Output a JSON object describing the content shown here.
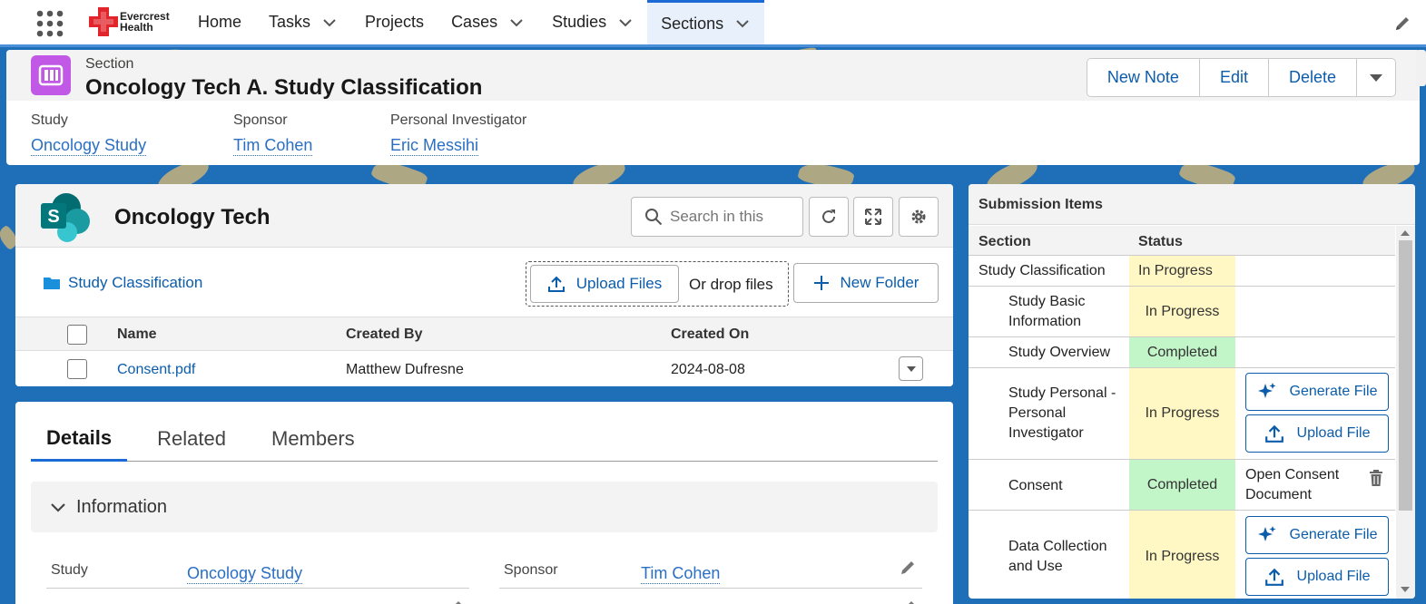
{
  "brand": {
    "line1": "Evercrest",
    "line2": "Health"
  },
  "nav": {
    "items": [
      {
        "label": "Home"
      },
      {
        "label": "Tasks"
      },
      {
        "label": "Projects"
      },
      {
        "label": "Cases"
      },
      {
        "label": "Studies"
      },
      {
        "label": "Sections"
      }
    ]
  },
  "record": {
    "object_label": "Section",
    "title": "Oncology Tech A. Study Classification",
    "buttons": {
      "new_note": "New Note",
      "edit": "Edit",
      "delete": "Delete"
    },
    "fields": [
      {
        "label": "Study",
        "value": "Oncology Study"
      },
      {
        "label": "Sponsor",
        "value": "Tim Cohen"
      },
      {
        "label": "Personal Investigator",
        "value": "Eric Messihi"
      }
    ]
  },
  "files": {
    "title": "Oncology Tech",
    "search_placeholder": "Search in this",
    "folder": "Study Classification",
    "upload_label": "Upload Files",
    "drop_label": "Or drop files",
    "new_folder_label": "New Folder",
    "columns": {
      "name": "Name",
      "created_by": "Created By",
      "created_on": "Created On"
    },
    "rows": [
      {
        "name": "Consent.pdf",
        "created_by": "Matthew Dufresne",
        "created_on": "2024-08-08"
      }
    ]
  },
  "details": {
    "tabs": [
      {
        "label": "Details"
      },
      {
        "label": "Related"
      },
      {
        "label": "Members"
      }
    ],
    "section_title": "Information",
    "fields": [
      {
        "label": "Study",
        "value": "Oncology Study"
      },
      {
        "label": "Sponsor",
        "value": "Tim Cohen"
      }
    ]
  },
  "submission": {
    "title": "Submission Items",
    "columns": {
      "section": "Section",
      "status": "Status"
    },
    "items": [
      {
        "name": "Study Classification",
        "status": "In Progress"
      },
      {
        "name": "Study Basic Information",
        "status": "In Progress"
      },
      {
        "name": "Study Overview",
        "status": "Completed"
      },
      {
        "name": "Study Personal - Personal Investigator",
        "status": "In Progress",
        "actions": [
          "Generate File",
          "Upload File"
        ]
      },
      {
        "name": "Consent",
        "status": "Completed",
        "link": "Open Consent Document"
      },
      {
        "name": "Data Collection and Use",
        "status": "In Progress",
        "actions": [
          "Generate File",
          "Upload File"
        ]
      }
    ]
  },
  "colors": {
    "accent": "#1b6ad6",
    "in_progress": "#fff8c4",
    "completed": "#c2f5c8",
    "section_icon": "#c158e6"
  },
  "icons": {
    "waffle": "app-launcher-icon",
    "pencil": "edit-pencil-icon",
    "search": "search-icon",
    "refresh": "refresh-icon",
    "expand": "expand-icon",
    "settings": "gear-icon",
    "folder": "folder-icon",
    "upload": "upload-icon",
    "add": "plus-icon",
    "sparkle": "sparkle-icon",
    "trash": "trash-icon"
  }
}
